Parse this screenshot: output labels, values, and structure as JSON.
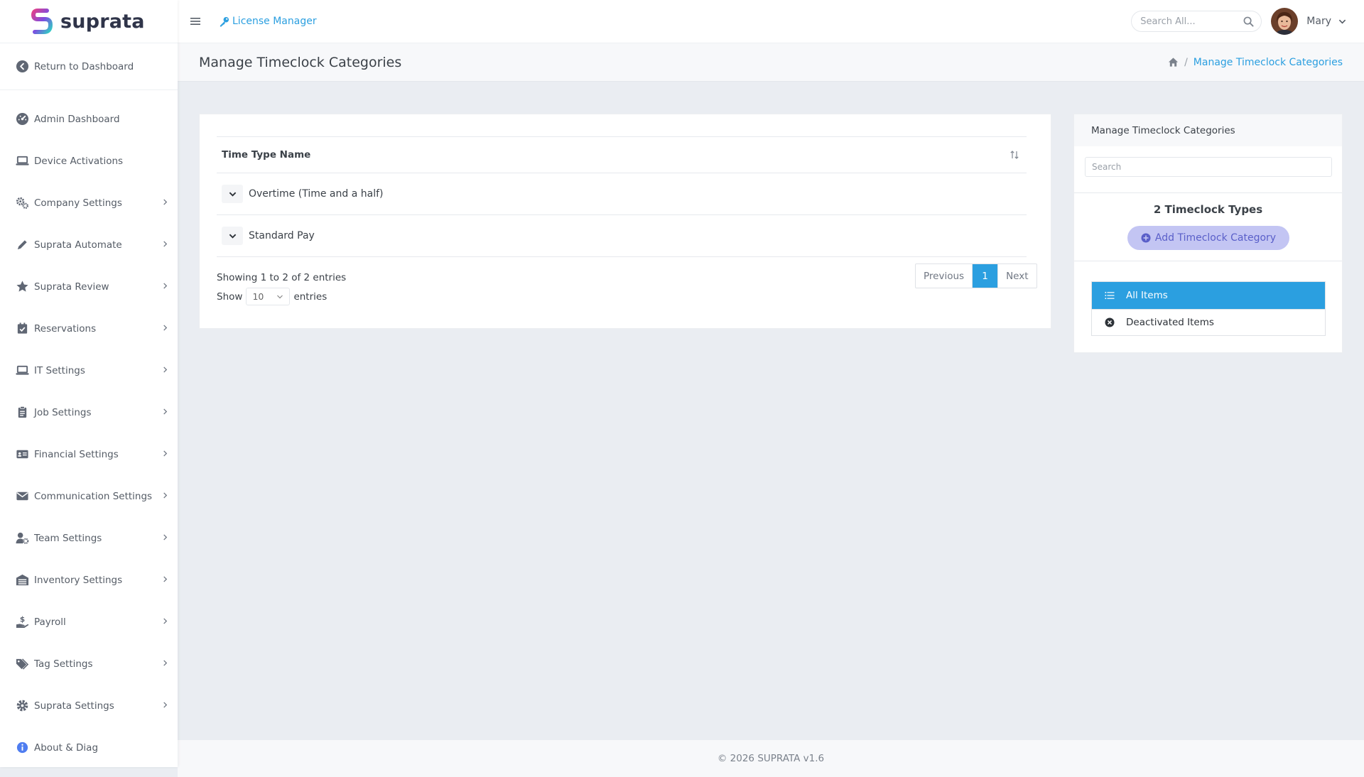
{
  "brand": {
    "name": "suprata"
  },
  "sidebar": {
    "return_label": "Return to Dashboard",
    "items": [
      {
        "label": "Admin Dashboard",
        "icon": "gauge-icon",
        "has_children": false
      },
      {
        "label": "Device Activations",
        "icon": "laptop-icon",
        "has_children": false
      },
      {
        "label": "Company Settings",
        "icon": "gears-icon",
        "has_children": true
      },
      {
        "label": "Suprata Automate",
        "icon": "pen-icon",
        "has_children": true
      },
      {
        "label": "Suprata Review",
        "icon": "star-icon",
        "has_children": true
      },
      {
        "label": "Reservations",
        "icon": "calendar-check-icon",
        "has_children": true
      },
      {
        "label": "IT Settings",
        "icon": "laptop-icon",
        "has_children": true
      },
      {
        "label": "Job Settings",
        "icon": "clipboard-icon",
        "has_children": true
      },
      {
        "label": "Financial Settings",
        "icon": "id-card-icon",
        "has_children": true
      },
      {
        "label": "Communication Settings",
        "icon": "envelope-icon",
        "has_children": true
      },
      {
        "label": "Team Settings",
        "icon": "user-gear-icon",
        "has_children": true
      },
      {
        "label": "Inventory Settings",
        "icon": "warehouse-icon",
        "has_children": true
      },
      {
        "label": "Payroll",
        "icon": "hand-dollar-icon",
        "has_children": true
      },
      {
        "label": "Tag Settings",
        "icon": "tags-icon",
        "has_children": true
      },
      {
        "label": "Suprata Settings",
        "icon": "gear-icon",
        "has_children": true
      },
      {
        "label": "About & Diag",
        "icon": "info-circle-icon",
        "has_children": false
      }
    ]
  },
  "topbar": {
    "license_link": "License Manager",
    "search_placeholder": "Search All...",
    "user_name": "Mary"
  },
  "page": {
    "title": "Manage Timeclock Categories",
    "breadcrumb_current": "Manage Timeclock Categories"
  },
  "table": {
    "column_header": "Time Type Name",
    "rows": [
      "Overtime (Time and a half)",
      "Standard Pay"
    ],
    "showing_text": "Showing 1 to 2 of 2 entries",
    "show_label": "Show",
    "entries_label": "entries",
    "page_size": "10",
    "pager": {
      "previous": "Previous",
      "current": "1",
      "next": "Next"
    }
  },
  "side_panel": {
    "title": "Manage Timeclock Categories",
    "search_placeholder": "Search",
    "count_title": "2 Timeclock Types",
    "add_button": "Add Timeclock Category",
    "filters": [
      {
        "label": "All Items",
        "active": true
      },
      {
        "label": "Deactivated Items",
        "active": false
      }
    ]
  },
  "footer": {
    "text": "© 2026 SUPRATA v1.6"
  },
  "colors": {
    "accent": "#2b9fe0",
    "add_button_bg": "#c3c5f3",
    "add_button_text": "#5a5fc9",
    "page_bg": "#eaedf2"
  }
}
